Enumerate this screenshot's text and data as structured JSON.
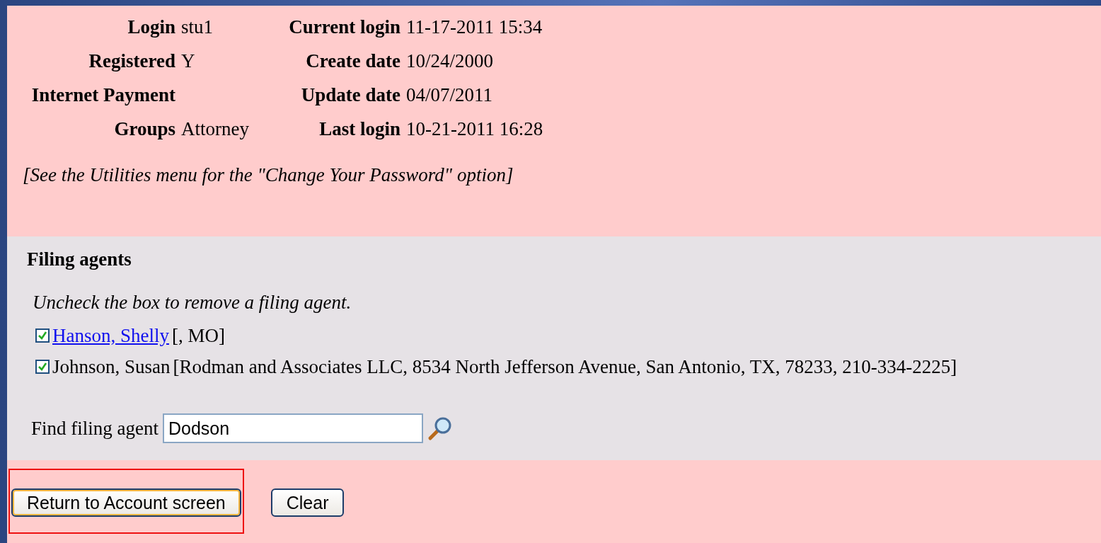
{
  "account": {
    "rows": [
      {
        "left": {
          "label": "Login",
          "value": "stu1"
        },
        "right": {
          "label": "Current login",
          "value": "11-17-2011 15:34"
        }
      },
      {
        "left": {
          "label": "Registered",
          "value": "Y"
        },
        "right": {
          "label": "Create date",
          "value": "10/24/2000"
        }
      },
      {
        "left": {
          "label": "Internet Payment"
        },
        "right": {
          "label": "Update date",
          "value": "04/07/2011"
        }
      },
      {
        "left": {
          "label": "Groups",
          "value": "Attorney"
        },
        "right": {
          "label": "Last login",
          "value": "10-21-2011 16:28"
        }
      }
    ],
    "note": "[See the Utilities menu for the \"Change Your Password\" option]"
  },
  "filing_agents": {
    "title": "Filing agents",
    "instruction": "Uncheck the box to remove a filing agent.",
    "agents": [
      {
        "name": "Hanson, Shelly",
        "detail": "[, MO]",
        "link": true,
        "checked": true
      },
      {
        "name": "Johnson, Susan",
        "detail": "[Rodman and Associates LLC, 8534 North Jefferson Avenue, San Antonio, TX, 78233, 210-334-2225]",
        "link": false,
        "checked": true
      }
    ],
    "find": {
      "label": "Find filing agent",
      "value": "Dodson"
    }
  },
  "buttons": [
    {
      "label": "Return to Account screen",
      "focused": true,
      "highlighted": true
    },
    {
      "label": "Clear",
      "focused": false,
      "highlighted": false
    }
  ]
}
